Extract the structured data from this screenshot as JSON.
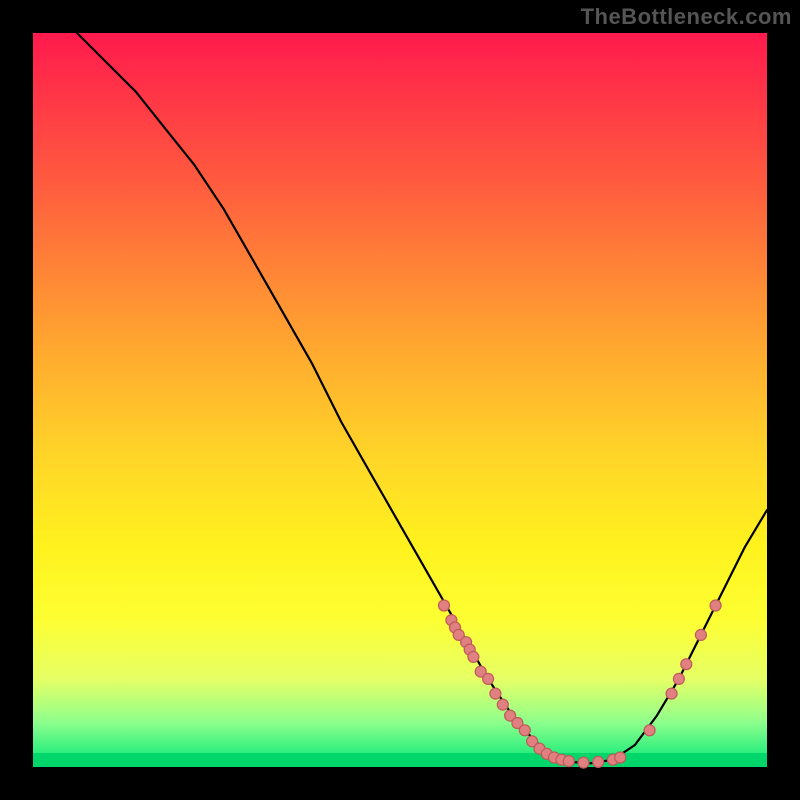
{
  "watermark": "TheBottleneck.com",
  "colors": {
    "page_bg": "#000000",
    "curve": "#000000",
    "dot_fill": "#e08080",
    "dot_stroke": "#c05a5a",
    "gradient_top": "#ff1a4d",
    "gradient_bottom": "#00e676"
  },
  "chart_data": {
    "type": "line",
    "title": "",
    "xlabel": "",
    "ylabel": "",
    "xlim": [
      0,
      100
    ],
    "ylim": [
      0,
      100
    ],
    "grid": false,
    "curve": [
      {
        "x": 6,
        "y": 100
      },
      {
        "x": 10,
        "y": 96
      },
      {
        "x": 14,
        "y": 92
      },
      {
        "x": 18,
        "y": 87
      },
      {
        "x": 22,
        "y": 82
      },
      {
        "x": 26,
        "y": 76
      },
      {
        "x": 30,
        "y": 69
      },
      {
        "x": 34,
        "y": 62
      },
      {
        "x": 38,
        "y": 55
      },
      {
        "x": 42,
        "y": 47
      },
      {
        "x": 46,
        "y": 40
      },
      {
        "x": 50,
        "y": 33
      },
      {
        "x": 54,
        "y": 26
      },
      {
        "x": 58,
        "y": 19
      },
      {
        "x": 62,
        "y": 12
      },
      {
        "x": 66,
        "y": 6
      },
      {
        "x": 70,
        "y": 2
      },
      {
        "x": 73,
        "y": 0.7
      },
      {
        "x": 76,
        "y": 0.5
      },
      {
        "x": 79,
        "y": 1
      },
      {
        "x": 82,
        "y": 3
      },
      {
        "x": 85,
        "y": 7
      },
      {
        "x": 88,
        "y": 12
      },
      {
        "x": 91,
        "y": 18
      },
      {
        "x": 94,
        "y": 24
      },
      {
        "x": 97,
        "y": 30
      },
      {
        "x": 100,
        "y": 35
      }
    ],
    "markers": [
      {
        "x": 56,
        "y": 22
      },
      {
        "x": 57,
        "y": 20
      },
      {
        "x": 57.5,
        "y": 19
      },
      {
        "x": 58,
        "y": 18
      },
      {
        "x": 59,
        "y": 17
      },
      {
        "x": 59.5,
        "y": 16
      },
      {
        "x": 60,
        "y": 15
      },
      {
        "x": 61,
        "y": 13
      },
      {
        "x": 62,
        "y": 12
      },
      {
        "x": 63,
        "y": 10
      },
      {
        "x": 64,
        "y": 8.5
      },
      {
        "x": 65,
        "y": 7
      },
      {
        "x": 66,
        "y": 6
      },
      {
        "x": 67,
        "y": 5
      },
      {
        "x": 68,
        "y": 3.5
      },
      {
        "x": 69,
        "y": 2.5
      },
      {
        "x": 70,
        "y": 1.8
      },
      {
        "x": 71,
        "y": 1.3
      },
      {
        "x": 72,
        "y": 1
      },
      {
        "x": 73,
        "y": 0.8
      },
      {
        "x": 75,
        "y": 0.6
      },
      {
        "x": 77,
        "y": 0.7
      },
      {
        "x": 79,
        "y": 1
      },
      {
        "x": 80,
        "y": 1.3
      },
      {
        "x": 84,
        "y": 5
      },
      {
        "x": 87,
        "y": 10
      },
      {
        "x": 88,
        "y": 12
      },
      {
        "x": 89,
        "y": 14
      },
      {
        "x": 91,
        "y": 18
      },
      {
        "x": 93,
        "y": 22
      }
    ]
  }
}
